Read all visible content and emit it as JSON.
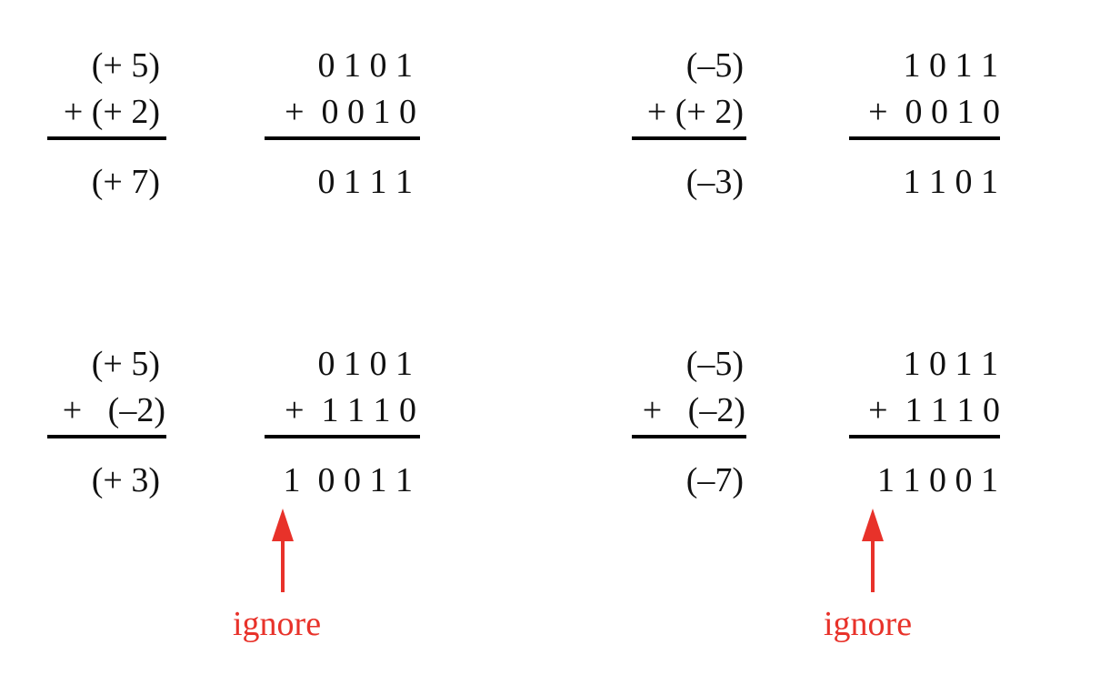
{
  "accent_color": "#e8322a",
  "problems": [
    {
      "decimal": {
        "top": "(+ 5)",
        "add": "+ (+ 2)",
        "result": "(+ 7)"
      },
      "binary": {
        "top": "0 1 0 1",
        "add": "+  0 0 1 0",
        "result": "0 1 1 1"
      },
      "ignore_label": ""
    },
    {
      "decimal": {
        "top": "(–5)",
        "add": "+ (+ 2)",
        "result": "(–3)"
      },
      "binary": {
        "top": "1 0 1 1",
        "add": "+  0 0 1 0",
        "result": "1 1 0 1"
      },
      "ignore_label": ""
    },
    {
      "decimal": {
        "top": "(+ 5)",
        "add": "+   (–2)",
        "result": "(+ 3)"
      },
      "binary": {
        "top": "0 1 0 1",
        "add": "+  1 1 1 0",
        "result": "1  0 0 1 1"
      },
      "ignore_label": "ignore"
    },
    {
      "decimal": {
        "top": "(–5)",
        "add": "+   (–2)",
        "result": "(–7)"
      },
      "binary": {
        "top": "1 0 1 1",
        "add": "+  1 1 1 0",
        "result": "1 1 0 0 1"
      },
      "ignore_label": "ignore"
    }
  ]
}
